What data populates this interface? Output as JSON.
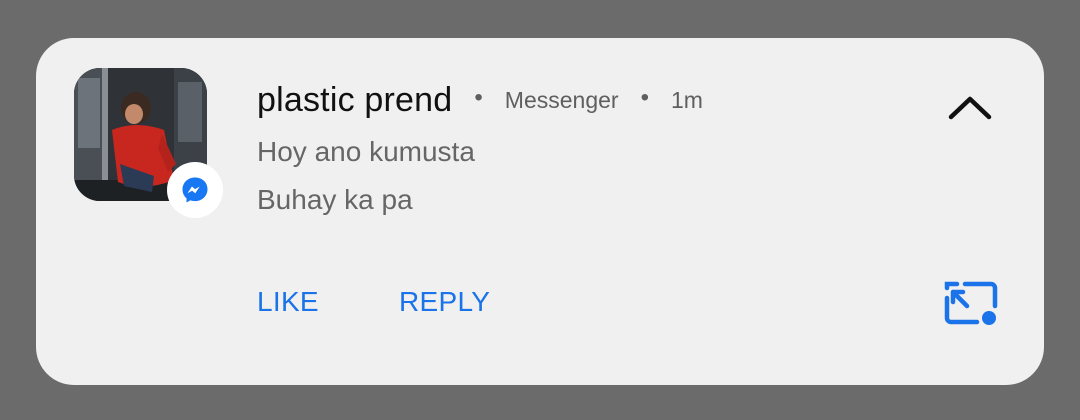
{
  "notification": {
    "sender": "plastic prend",
    "separator": "•",
    "app_name": "Messenger",
    "time": "1m",
    "messages": [
      "Hoy ano kumusta",
      "Buhay ka pa"
    ],
    "actions": {
      "like_label": "LIKE",
      "reply_label": "REPLY"
    },
    "icons": {
      "app_badge": "messenger-icon",
      "collapse": "chevron-up-icon",
      "popout": "open-in-bubble-icon"
    },
    "colors": {
      "accent": "#1a73e8",
      "card_bg": "#f0f0f0",
      "scrim": "#6b6b6b"
    }
  }
}
